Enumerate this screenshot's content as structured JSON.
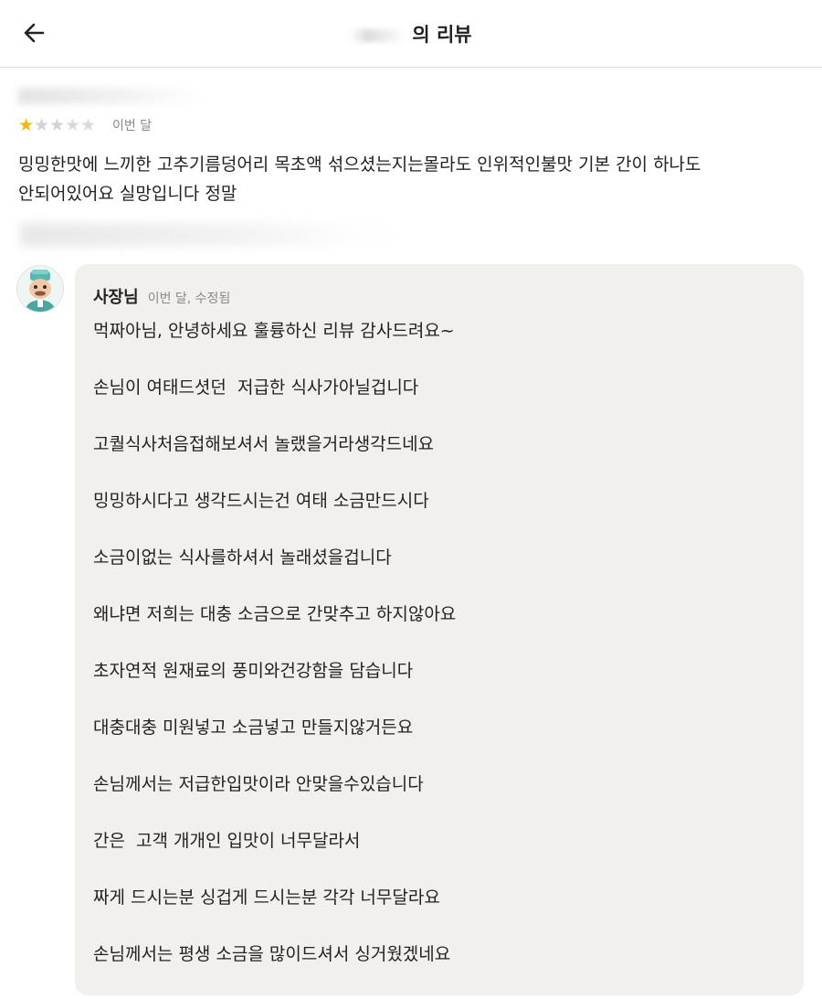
{
  "header": {
    "title": "의 리뷰",
    "back_icon": "arrow-left-icon"
  },
  "review": {
    "rating": 1,
    "max_rating": 5,
    "date": "이번 달",
    "text_line1": "밍밍한맛에 느끼한 고추기름덩어리 목초액 섞으셨는지는몰라도 인위적인불맛 기본 간이 하나도",
    "text_line2": "안되어있어요 실망입니다 정말",
    "star_color": "#f5b800"
  },
  "reply": {
    "author": "사장님",
    "meta": "이번 달, 수정됨",
    "lines": [
      "먹짜아님, 안녕하세요 훌륭하신 리뷰 감사드려요~",
      "손님이 여태드셧던  저급한 식사가아닐겁니다",
      "고퀄식사처음접해보셔서 놀랬을거라생각드네요",
      "밍밍하시다고 생각드시는건 여태 소금만드시다",
      "소금이없는 식사를하셔서 놀래셨을겁니다",
      "왜냐면 저희는 대충 소금으로 간맞추고 하지않아요",
      "초자연적 원재료의 풍미와건강함을 담습니다",
      "대충대충 미원넣고 소금넣고 만들지않거든요",
      "손님께서는 저급한입맛이라 안맞을수있습니다",
      "간은  고객 개개인 입맛이 너무달라서",
      "짜게 드시는분 싱겁게 드시는분 각각 너무달라요",
      "손님께서는 평생 소금을 많이드셔서 싱거웠겠네요"
    ],
    "bubble_color": "#f2f0ed"
  }
}
